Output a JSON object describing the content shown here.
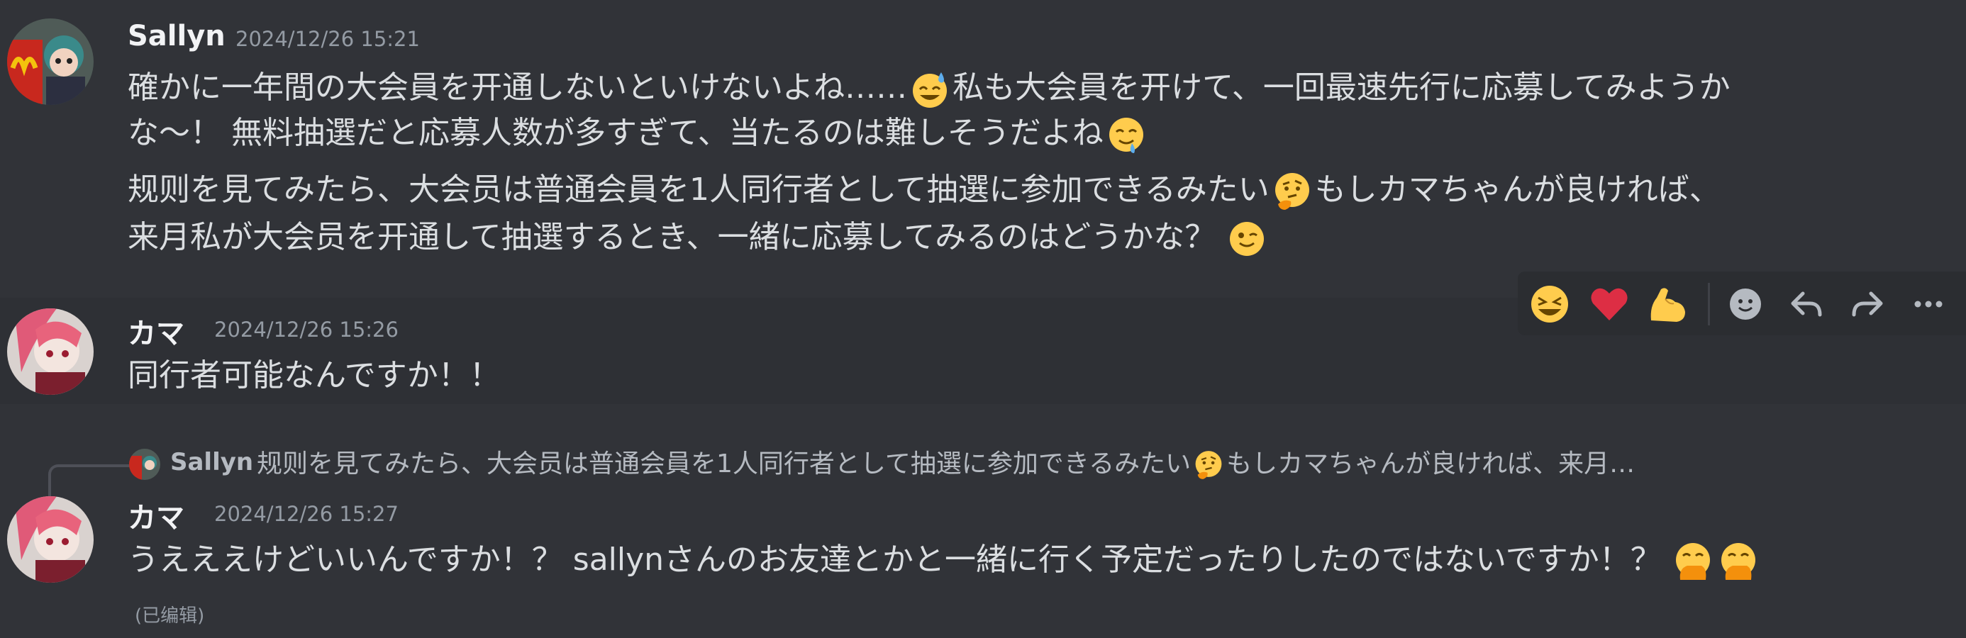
{
  "messages": [
    {
      "username": "Sallyn",
      "timestamp": "2024/12/26 15:21",
      "lines": [
        {
          "a": "確かに一年間の大会員を开通しないといけないよね……",
          "b": "私も大会員を开けて、一回最速先行に応募してみようか"
        },
        {
          "a": "な～！ 無料抽選だと応募人数が多すぎて、当たるのは難しそうだよね",
          "b": ""
        },
        {
          "a": "规则を見てみたら、大会员は普通会員を1人同行者として抽選に参加できるみたい",
          "b": "もしカマちゃんが良ければ、"
        },
        {
          "a": "来月私が大会员を开通して抽選するとき、一緒に応募してみるのはどうかな？",
          "b": ""
        }
      ]
    },
    {
      "username": "カマ",
      "timestamp": "2024/12/26 15:26",
      "text": "同行者可能なんですか！！"
    },
    {
      "reply": {
        "username": "Sallyn",
        "text_a": "规则を見てみたら、大会员は普通会員を1人同行者として抽選に参加できるみたい",
        "text_b": "もしカマちゃんが良ければ、来月…"
      },
      "username": "カマ",
      "timestamp": "2024/12/26 15:27",
      "text": "うえええけどいいんですか！？ sallynさんのお友達とかと一緒に行く予定だったりしたのではないですか！？",
      "edited": "(已编辑)"
    }
  ],
  "toolbar": {
    "reactions": [
      "laughing-emoji",
      "heart-emoji",
      "flexed-biceps-emoji"
    ],
    "actions": [
      "add-reaction",
      "reply",
      "forward",
      "more"
    ]
  },
  "colors": {
    "background": "#313338",
    "hover_background": "#2e3035",
    "text": "#dbdee1",
    "username": "#f2f3f5",
    "timestamp": "#949ba4",
    "emoji_yellow": "#ffcc4d"
  }
}
